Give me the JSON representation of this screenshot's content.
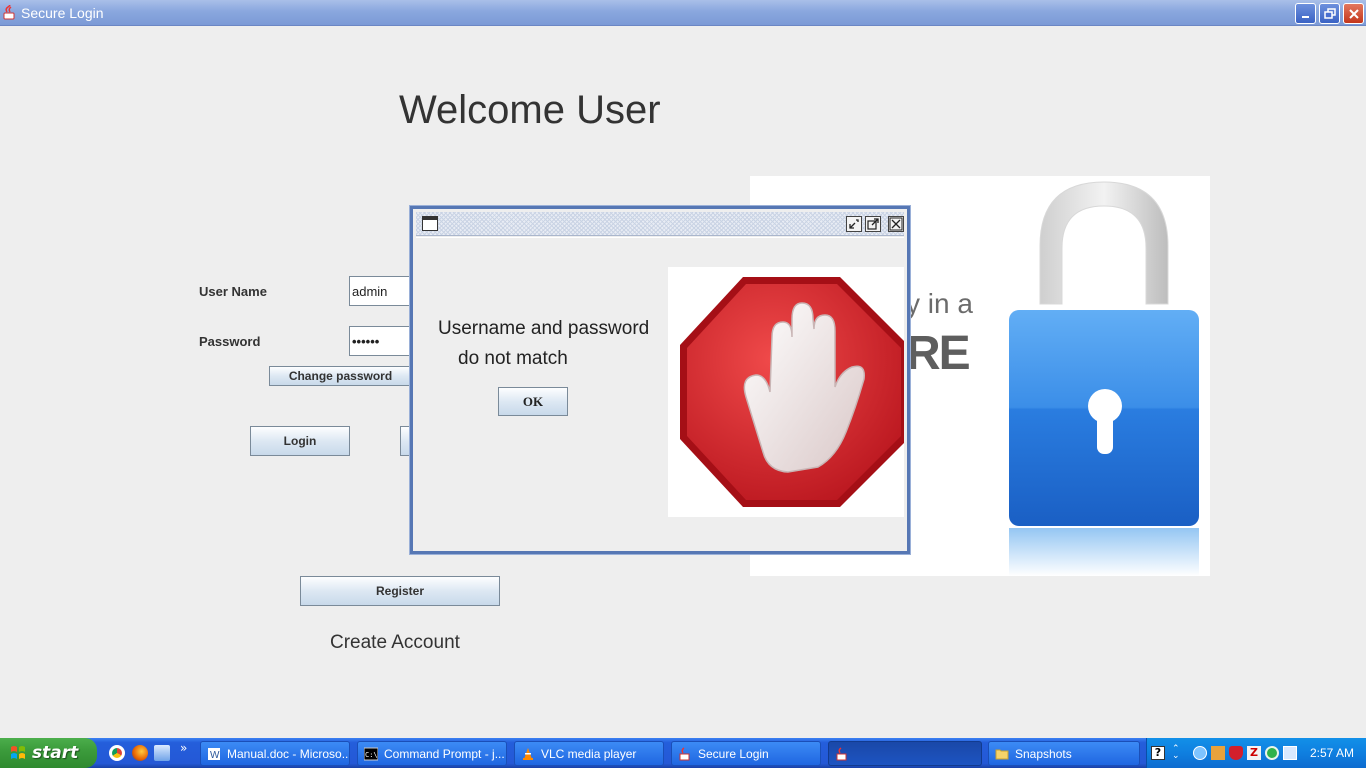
{
  "window": {
    "title": "Secure Login"
  },
  "main": {
    "heading": "Welcome User",
    "username_label": "User Name",
    "username_value": "admin",
    "password_label": "Password",
    "password_value": "••••••",
    "change_password_label": "Change password",
    "login_label": "Login",
    "register_label": "Register",
    "create_account_text": "Create Account",
    "panel_text_line1": "y in a",
    "panel_text_line2": "RE"
  },
  "dialog": {
    "message_line1": "Username and password",
    "message_line2": "do not match",
    "ok_label": "OK",
    "image_icon": "stop-hand-icon"
  },
  "taskbar": {
    "start_label": "start",
    "tasks": [
      {
        "label": "Manual.doc - Microso...",
        "icon": "word-doc-icon"
      },
      {
        "label": "Command Prompt - j...",
        "icon": "cmd-icon"
      },
      {
        "label": "VLC media player",
        "icon": "vlc-icon"
      },
      {
        "label": "Secure Login",
        "icon": "java-icon"
      },
      {
        "label": "",
        "icon": "java-icon"
      },
      {
        "label": "Snapshots",
        "icon": "folder-icon"
      }
    ],
    "clock": "2:57 AM",
    "quicklaunch_overflow": "»"
  },
  "colors": {
    "titlebar": "#8aa7de",
    "taskbar": "#245edb",
    "start_green": "#3c9c3c",
    "stop_red": "#d9262b",
    "lock_blue": "#2f7fe0"
  }
}
